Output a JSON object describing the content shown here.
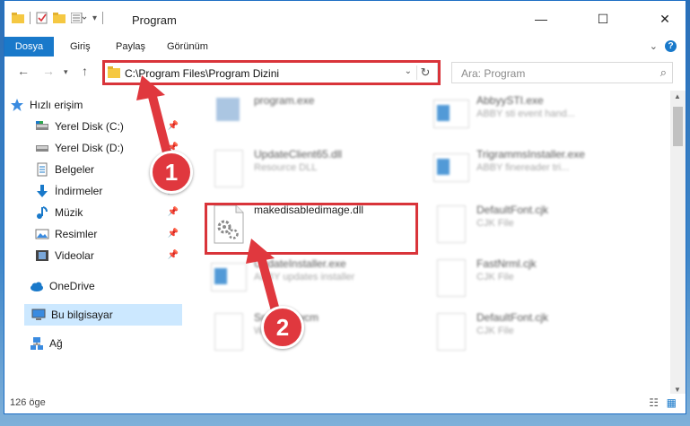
{
  "window": {
    "title": "Program",
    "minimize": "—",
    "maximize": "☐",
    "close": "✕"
  },
  "ribbon": {
    "tabs": [
      "Dosya",
      "Giriş",
      "Paylaş",
      "Görünüm"
    ],
    "help": "?"
  },
  "navigation": {
    "address": "C:\\Program Files\\Program Dizini",
    "search_placeholder": "Ara: Program"
  },
  "sidebar": {
    "items": [
      {
        "label": "Hızlı erişim",
        "icon": "star-icon"
      },
      {
        "label": "Yerel Disk (C:)",
        "icon": "drive-icon"
      },
      {
        "label": "Yerel Disk (D:)",
        "icon": "drive-icon"
      },
      {
        "label": "Belgeler",
        "icon": "documents-icon"
      },
      {
        "label": "İndirmeler",
        "icon": "download-icon"
      },
      {
        "label": "Müzik",
        "icon": "music-icon"
      },
      {
        "label": "Resimler",
        "icon": "pictures-icon"
      },
      {
        "label": "Videolar",
        "icon": "video-icon"
      },
      {
        "label": "OneDrive",
        "icon": "cloud-icon"
      },
      {
        "label": "Bu bilgisayar",
        "icon": "computer-icon"
      },
      {
        "label": "Ağ",
        "icon": "network-icon"
      }
    ]
  },
  "files": [
    {
      "name": "program.exe",
      "sub": ""
    },
    {
      "name": "AbbyySTI.exe",
      "sub": "ABBY sti event hand..."
    },
    {
      "name": "UpdateClient65.dll",
      "sub": "Resource DLL"
    },
    {
      "name": "TrigrammsInstaller.exe",
      "sub": "ABBY finereader tri..."
    },
    {
      "name": "makedisabledimage.dll",
      "sub": ""
    },
    {
      "name": "DefaultFont.cjk",
      "sub": "CJK File"
    },
    {
      "name": "UpdateInstaller.exe",
      "sub": "ABBY updates installer"
    },
    {
      "name": "FastNrml.cjk",
      "sub": "CJK File"
    },
    {
      "name": "Snc...06.wcm",
      "sub": "WC..."
    },
    {
      "name": "DefaultFont.cjk",
      "sub": "CJK File"
    }
  ],
  "annotations": [
    "1",
    "2"
  ],
  "status": {
    "count": "126 öge"
  },
  "colors": {
    "accent": "#1979ca",
    "highlight": "#d9343a",
    "selected": "#cce8ff"
  }
}
